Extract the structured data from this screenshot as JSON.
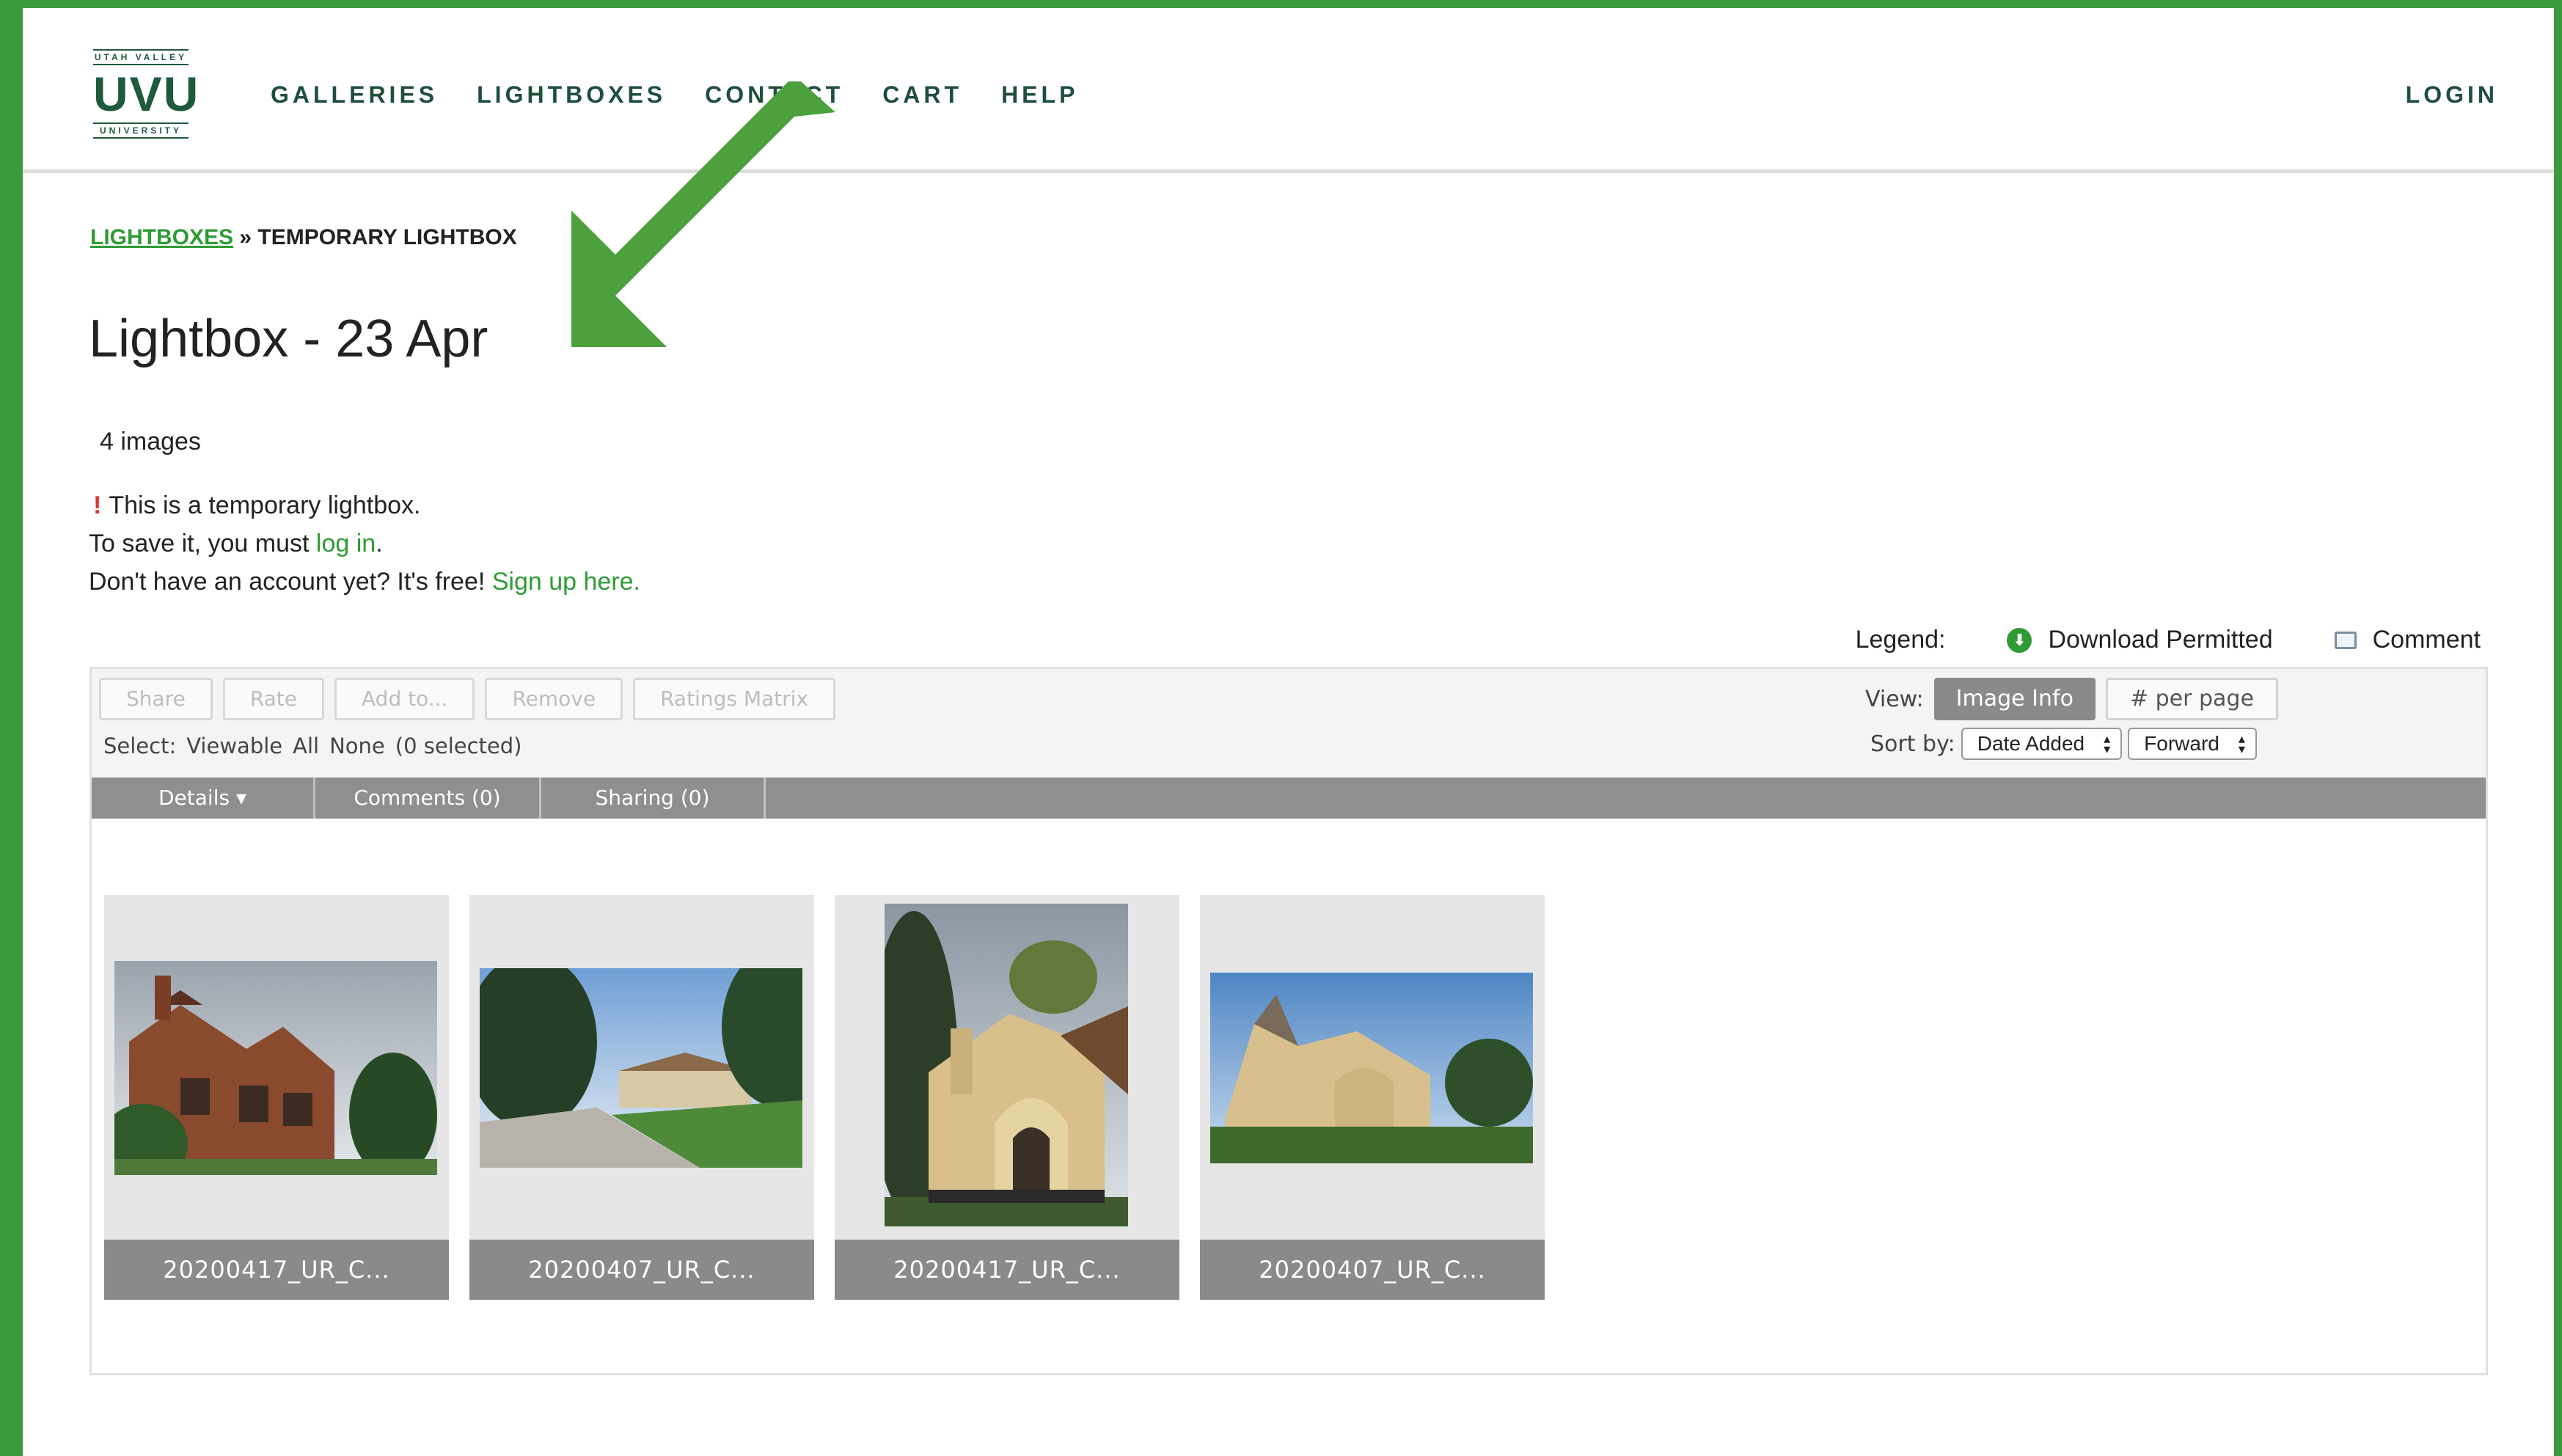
{
  "logo": {
    "top": "UTAH VALLEY",
    "main": "UVU",
    "bottom": "UNIVERSITY"
  },
  "nav": {
    "items": [
      {
        "label": "GALLERIES"
      },
      {
        "label": "LIGHTBOXES"
      },
      {
        "label": "CONTACT"
      },
      {
        "label": "CART"
      },
      {
        "label": "HELP"
      }
    ],
    "login": "LOGIN"
  },
  "breadcrumb": {
    "link": "LIGHTBOXES",
    "separator": " » ",
    "current": "TEMPORARY LIGHTBOX"
  },
  "page": {
    "title": "Lightbox - 23 Apr",
    "image_count": "4 images"
  },
  "notice": {
    "mark": "!",
    "line1": "This is a temporary lightbox.",
    "line2_prefix": "To save it, you must ",
    "line2_link": "log in",
    "line2_suffix": ".",
    "line3_prefix": "Don't have an account yet? It's free! ",
    "line3_link": "Sign up here."
  },
  "legend": {
    "label": "Legend:",
    "download": "Download Permitted",
    "comment": "Comment"
  },
  "toolbar": {
    "buttons": [
      {
        "label": "Share"
      },
      {
        "label": "Rate"
      },
      {
        "label": "Add to..."
      },
      {
        "label": "Remove"
      },
      {
        "label": "Ratings Matrix"
      }
    ],
    "select_label": "Select:",
    "select_viewable": "Viewable",
    "select_all": "All",
    "select_none": "None",
    "selected_count": "(0 selected)",
    "view_label": "View:",
    "view_image_info": "Image Info",
    "view_per_page": "# per page",
    "sort_label": "Sort by:",
    "sort_field": "Date Added",
    "sort_direction": "Forward"
  },
  "tabs": [
    {
      "label": "Details ▾"
    },
    {
      "label": "Comments (0)"
    },
    {
      "label": "Sharing (0)"
    }
  ],
  "thumbnails": [
    {
      "caption": "20200417_UR_C..."
    },
    {
      "caption": "20200407_UR_C..."
    },
    {
      "caption": "20200417_UR_C..."
    },
    {
      "caption": "20200407_UR_C..."
    }
  ],
  "colors": {
    "frame": "#3b9a3b",
    "link_green": "#2e9b34",
    "nav_text": "#1f4f3a",
    "arrow": "#4ca03d",
    "tabbar": "#8f8f8f"
  }
}
